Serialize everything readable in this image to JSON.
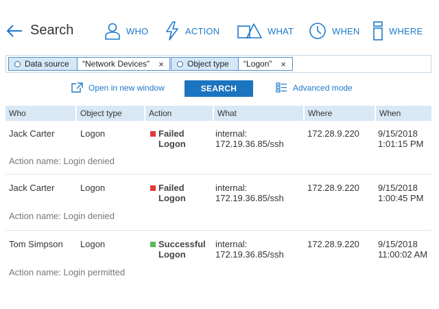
{
  "header": {
    "title": "Search",
    "nav": [
      {
        "label": "WHO",
        "icon": "person-icon"
      },
      {
        "label": "ACTION",
        "icon": "lightning-icon"
      },
      {
        "label": "WHAT",
        "icon": "shapes-icon"
      },
      {
        "label": "WHEN",
        "icon": "clock-icon"
      },
      {
        "label": "WHERE",
        "icon": "server-icon"
      }
    ]
  },
  "filters": [
    {
      "key": "Data source",
      "value": "“Network Devices”",
      "remove": "×"
    },
    {
      "key": "Object type",
      "value": "“Logon”",
      "remove": "×"
    }
  ],
  "actions": {
    "open_window": "Open in new window",
    "search": "SEARCH",
    "advanced": "Advanced mode"
  },
  "colors": {
    "accent": "#1b74bf",
    "failed": "#e03a3a",
    "success": "#5cb85c"
  },
  "table": {
    "headers": [
      "Who",
      "Object type",
      "Action",
      "What",
      "Where",
      "When"
    ],
    "rows": [
      {
        "who": "Jack Carter",
        "object_type": "Logon",
        "action_line1": "Failed",
        "action_line2": "Logon",
        "status": "failed",
        "what_line1": "internal:",
        "what_line2": "172.19.36.85/ssh",
        "where": "172.28.9.220",
        "when_line1": "9/15/2018",
        "when_line2": "1:01:15 PM",
        "detail": "Action name: Login denied"
      },
      {
        "who": "Jack Carter",
        "object_type": "Logon",
        "action_line1": "Failed",
        "action_line2": "Logon",
        "status": "failed",
        "what_line1": "internal:",
        "what_line2": "172.19.36.85/ssh",
        "where": "172.28.9.220",
        "when_line1": "9/15/2018",
        "when_line2": "1:00:45 PM",
        "detail": "Action name: Login denied"
      },
      {
        "who": "Tom Simpson",
        "object_type": "Logon",
        "action_line1": "Successful",
        "action_line2": "Logon",
        "status": "success",
        "what_line1": "internal:",
        "what_line2": "172.19.36.85/ssh",
        "where": "172.28.9.220",
        "when_line1": "9/15/2018",
        "when_line2": "11:00:02 AM",
        "detail": "Action name: Login permitted"
      }
    ]
  }
}
